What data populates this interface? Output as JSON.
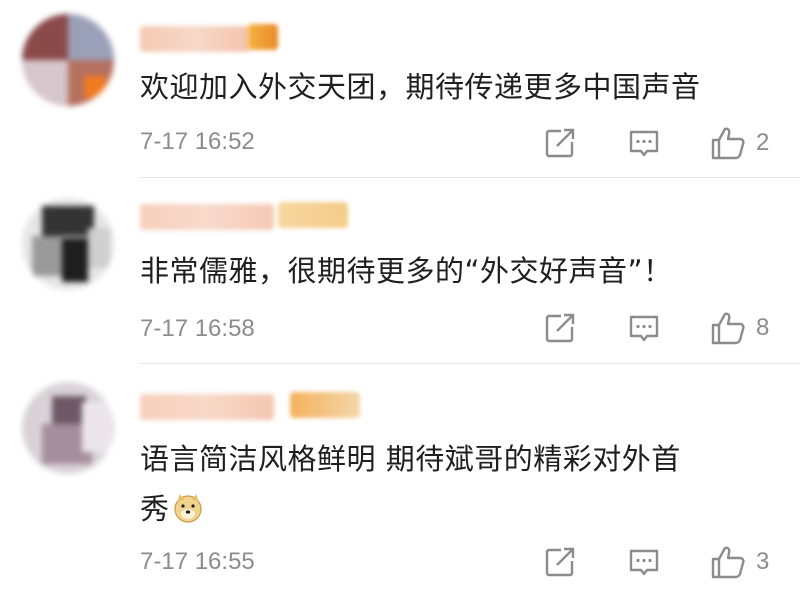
{
  "comments": [
    {
      "text": "欢迎加入外交天团，期待传递更多中国声音",
      "time": "7-17 16:52",
      "likes": "2",
      "has_emoji": false
    },
    {
      "text": "非常儒雅，很期待更多的“外交好声音”！",
      "time": "7-17 16:58",
      "likes": "8",
      "has_emoji": false
    },
    {
      "text": "语言简洁风格鲜明 期待斌哥的精彩对外首",
      "text_line2": "秀",
      "time": "7-17 16:55",
      "likes": "3",
      "has_emoji": true,
      "emoji_name": "doge-emoji"
    }
  ],
  "icons": {
    "share": "share-icon",
    "comment": "comment-icon",
    "like": "thumbs-up-icon"
  },
  "colors": {
    "text": "#1f1f1f",
    "meta": "#8c8c8c",
    "divider": "#e6e6e6",
    "icon": "#8c8c8c"
  }
}
